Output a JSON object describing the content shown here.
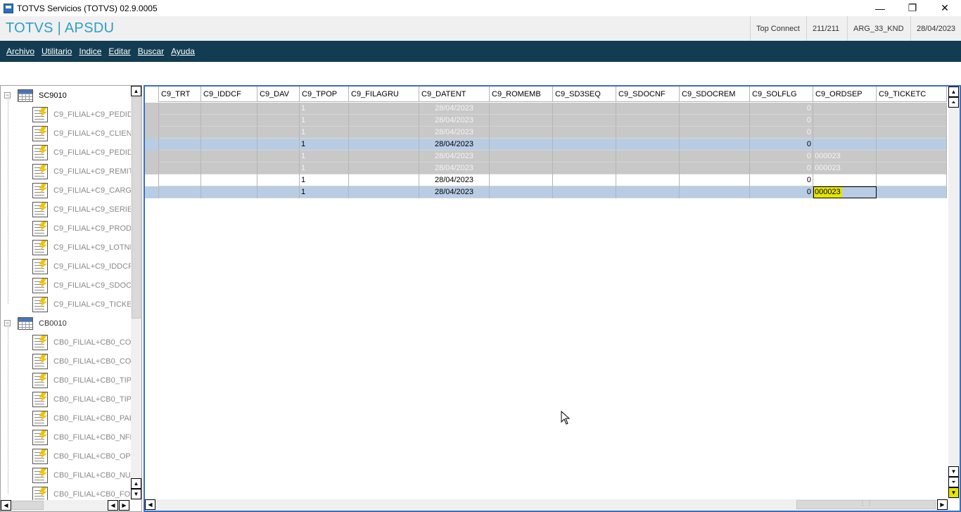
{
  "window": {
    "title": "TOTVS Servicios (TOTVS) 02.9.0005",
    "controls": {
      "minimize": "—",
      "restore": "❐",
      "close": "✕"
    }
  },
  "header": {
    "brand": "TOTVS | APSDU",
    "connection": "Top Connect",
    "counter": "211/211",
    "environment": "ARG_33_KND",
    "date": "28/04/2023"
  },
  "menu": [
    {
      "label": "Archivo"
    },
    {
      "label": "Utilitario"
    },
    {
      "label": "Indice"
    },
    {
      "label": "Editar"
    },
    {
      "label": "Buscar"
    },
    {
      "label": "Ayuda"
    }
  ],
  "tree": {
    "tables": [
      {
        "name": "SC9010",
        "toggle": "−",
        "indexes": [
          "C9_FILIAL+C9_PEDID",
          "C9_FILIAL+C9_CLIEN",
          "C9_FILIAL+C9_PEDID",
          "C9_FILIAL+C9_REMIT",
          "C9_FILIAL+C9_CARG",
          "C9_FILIAL+C9_SERIE",
          "C9_FILIAL+C9_PROD",
          "C9_FILIAL+C9_LOTNF",
          "C9_FILIAL+C9_IDDCF",
          "C9_FILIAL+C9_SDOC",
          "C9_FILIAL+C9_TICKET"
        ]
      },
      {
        "name": "CB0010",
        "toggle": "−",
        "indexes": [
          "CB0_FILIAL+CB0_CO",
          "CB0_FILIAL+CB0_CO",
          "CB0_FILIAL+CB0_TIP",
          "CB0_FILIAL+CB0_TIP",
          "CB0_FILIAL+CB0_PAL",
          "CB0_FILIAL+CB0_NFE",
          "CB0_FILIAL+CB0_OP",
          "CB0_FILIAL+CB0_NU",
          "CB0_FILIAL+CB0_FO"
        ]
      }
    ]
  },
  "grid": {
    "columns": [
      "",
      "C9_TRT",
      "C9_IDDCF",
      "C9_DAV",
      "C9_TPOP",
      "C9_FILAGRU",
      "C9_DATENT",
      "C9_ROMEMB",
      "C9_SD3SEQ",
      "C9_SDOCNF",
      "C9_SDOCREM",
      "C9_SOLFLG",
      "C9_ORDSEP",
      "C9_TICKETC"
    ],
    "rows": [
      {
        "style": "gray",
        "tpop": "1",
        "datent": "28/04/2023",
        "solflg": "0",
        "ordsep": ""
      },
      {
        "style": "gray",
        "tpop": "1",
        "datent": "28/04/2023",
        "solflg": "0",
        "ordsep": ""
      },
      {
        "style": "gray",
        "tpop": "1",
        "datent": "28/04/2023",
        "solflg": "0",
        "ordsep": ""
      },
      {
        "style": "blue",
        "tpop": "1",
        "datent": "28/04/2023",
        "solflg": "0",
        "ordsep": ""
      },
      {
        "style": "gray",
        "tpop": "1",
        "datent": "28/04/2023",
        "solflg": "0",
        "ordsep": "000023"
      },
      {
        "style": "gray",
        "tpop": "1",
        "datent": "28/04/2023",
        "solflg": "0",
        "ordsep": "000023"
      },
      {
        "style": "white",
        "tpop": "1",
        "datent": "28/04/2023",
        "solflg": "0",
        "ordsep": ""
      },
      {
        "style": "blue",
        "tpop": "1",
        "datent": "28/04/2023",
        "solflg": "0",
        "ordsep": "000023",
        "highlight": true
      }
    ]
  },
  "scroll": {
    "up": "▲",
    "down": "▼",
    "left": "◀",
    "right": "▶",
    "top": "⏶",
    "bottom": "⏷",
    "grip": "⋮⋮"
  }
}
